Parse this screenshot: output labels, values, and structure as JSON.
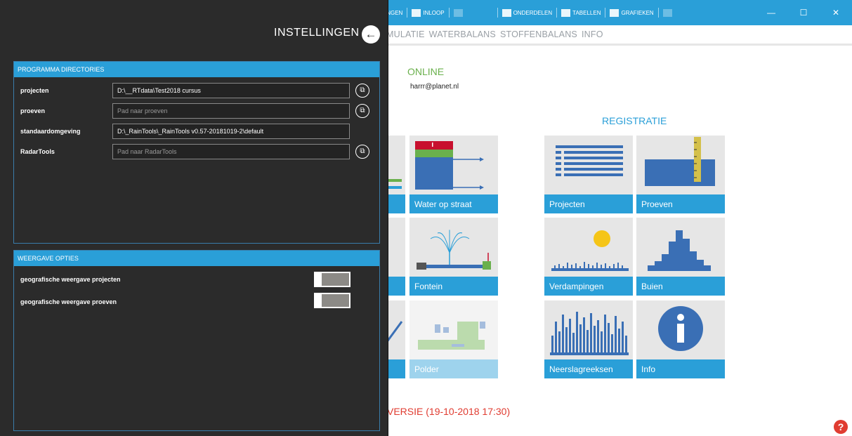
{
  "titlebar": {
    "items": [
      {
        "label": "INGEN",
        "icon": "settings-icon",
        "dim": false
      },
      {
        "label": "INLOOP",
        "icon": "inflow-icon",
        "dim": false
      },
      {
        "label": "",
        "icon": "generic-icon",
        "dim": true
      },
      {
        "label": "ONDERDELEN",
        "icon": "home-icon",
        "dim": false
      },
      {
        "label": "TABELLEN",
        "icon": "table-icon",
        "dim": false
      },
      {
        "label": "GRAFIEKEN",
        "icon": "chart-icon",
        "dim": false
      },
      {
        "label": "",
        "icon": "generic-icon",
        "dim": true
      }
    ],
    "window_controls": {
      "minimize": "—",
      "maximize": "☐",
      "close": "✕"
    }
  },
  "menubar": {
    "items": [
      "MULATIE",
      "WATERBALANS",
      "STOFFENBALANS",
      "INFO"
    ]
  },
  "status": {
    "online": "ONLINE",
    "email": "harrr@planet.nl",
    "registratie": "REGISTRATIE"
  },
  "tiles": [
    {
      "label": "Water op straat",
      "icon": "water-on-street-icon"
    },
    {
      "label": "Projecten",
      "icon": "list-icon"
    },
    {
      "label": "Proeven",
      "icon": "ruler-icon"
    },
    {
      "label": "Fontein",
      "icon": "fountain-icon"
    },
    {
      "label": "Verdampingen",
      "icon": "evaporation-icon"
    },
    {
      "label": "Buien",
      "icon": "histogram-icon"
    },
    {
      "label": "Polder",
      "icon": "polder-icon"
    },
    {
      "label": "Neerslagreeksen",
      "icon": "rainfall-series-icon"
    },
    {
      "label": "Info",
      "icon": "info-icon"
    }
  ],
  "version_text": "VERSIE (19-10-2018 17:30)",
  "help_label": "?",
  "settings": {
    "title": "INSTELLINGEN",
    "back_icon": "arrow-left-icon",
    "back_label": "←",
    "directories": {
      "header": "PROGRAMMA DIRECTORIES",
      "rows": [
        {
          "label": "projecten",
          "value": "D:\\__RTdata\\Test2018 cursus",
          "placeholder": "",
          "browse": true
        },
        {
          "label": "proeven",
          "value": "",
          "placeholder": "Pad naar proeven",
          "browse": true
        },
        {
          "label": "standaardomgeving",
          "value": "D:\\_RainTools\\_RainTools v0.57-20181019-2\\default",
          "placeholder": "",
          "browse": false
        },
        {
          "label": "RadarTools",
          "value": "",
          "placeholder": "Pad naar RadarTools",
          "browse": true
        }
      ],
      "browse_label": "⧉"
    },
    "display": {
      "header": "WEERGAVE OPTIES",
      "options": [
        {
          "label": "geografische weergave projecten",
          "enabled": false
        },
        {
          "label": "geografische weergave proeven",
          "enabled": false
        }
      ]
    }
  }
}
